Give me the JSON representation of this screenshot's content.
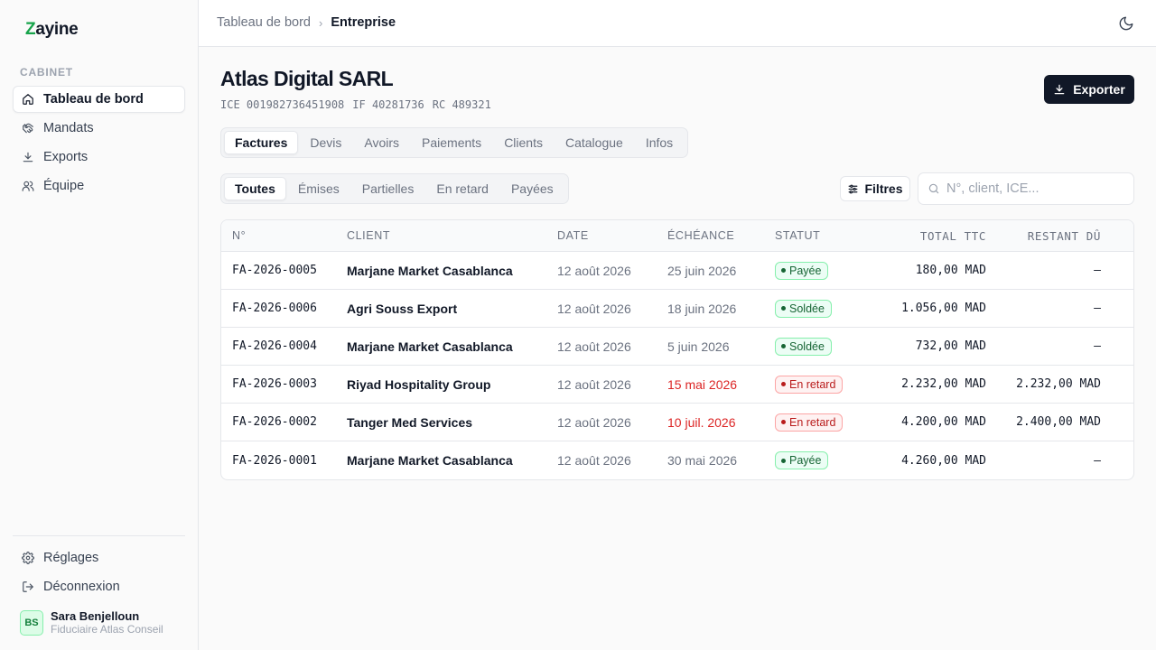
{
  "brand": {
    "logo_first": "Z",
    "logo_rest": "ayine",
    "accent": "#16a34a"
  },
  "sidebar": {
    "section_label": "CABINET",
    "items": [
      {
        "label": "Tableau de bord",
        "icon": "home-icon"
      },
      {
        "label": "Mandats",
        "icon": "handshake-icon"
      },
      {
        "label": "Exports",
        "icon": "download-icon"
      },
      {
        "label": "Équipe",
        "icon": "users-icon"
      }
    ],
    "bottom": [
      {
        "label": "Réglages",
        "icon": "gear-icon"
      },
      {
        "label": "Déconnexion",
        "icon": "logout-icon"
      }
    ],
    "user": {
      "initials": "BS",
      "name": "Sara Benjelloun",
      "org": "Fiduciaire Atlas Conseil"
    }
  },
  "topbar": {
    "breadcrumb": [
      "Tableau de bord",
      "Entreprise"
    ],
    "theme_icon": "moon-icon"
  },
  "company": {
    "name": "Atlas Digital SARL",
    "ice": "ICE 001982736451908",
    "if": "IF 40281736",
    "rc": "RC 489321",
    "export_label": "Exporter"
  },
  "tabs": [
    "Factures",
    "Devis",
    "Avoirs",
    "Paiements",
    "Clients",
    "Catalogue",
    "Infos"
  ],
  "active_tab": "Factures",
  "filters": [
    "Toutes",
    "Émises",
    "Partielles",
    "En retard",
    "Payées"
  ],
  "active_filter": "Toutes",
  "filters_button": "Filtres",
  "search": {
    "placeholder": "N°, client, ICE...",
    "value": ""
  },
  "table": {
    "headers": [
      "N°",
      "CLIENT",
      "DATE",
      "ÉCHÉANCE",
      "STATUT",
      "TOTAL TTC",
      "RESTANT DÛ"
    ],
    "rows": [
      {
        "num": "FA-2026-0005",
        "client": "Marjane Market Casablanca",
        "date": "12 août 2026",
        "due": "25 juin 2026",
        "due_late": false,
        "status": "Payée",
        "status_type": "ok",
        "total": "180,00 MAD",
        "rest": "—"
      },
      {
        "num": "FA-2026-0006",
        "client": "Agri Souss Export",
        "date": "12 août 2026",
        "due": "18 juin 2026",
        "due_late": false,
        "status": "Soldée",
        "status_type": "ok",
        "total": "1.056,00 MAD",
        "rest": "—"
      },
      {
        "num": "FA-2026-0004",
        "client": "Marjane Market Casablanca",
        "date": "12 août 2026",
        "due": "5 juin 2026",
        "due_late": false,
        "status": "Soldée",
        "status_type": "ok",
        "total": "732,00 MAD",
        "rest": "—"
      },
      {
        "num": "FA-2026-0003",
        "client": "Riyad Hospitality Group",
        "date": "12 août 2026",
        "due": "15 mai 2026",
        "due_late": true,
        "status": "En retard",
        "status_type": "late",
        "total": "2.232,00 MAD",
        "rest": "2.232,00 MAD"
      },
      {
        "num": "FA-2026-0002",
        "client": "Tanger Med Services",
        "date": "12 août 2026",
        "due": "10 juil. 2026",
        "due_late": true,
        "status": "En retard",
        "status_type": "late",
        "total": "4.200,00 MAD",
        "rest": "2.400,00 MAD"
      },
      {
        "num": "FA-2026-0001",
        "client": "Marjane Market Casablanca",
        "date": "12 août 2026",
        "due": "30 mai 2026",
        "due_late": false,
        "status": "Payée",
        "status_type": "ok",
        "total": "4.260,00 MAD",
        "rest": "—"
      }
    ]
  }
}
